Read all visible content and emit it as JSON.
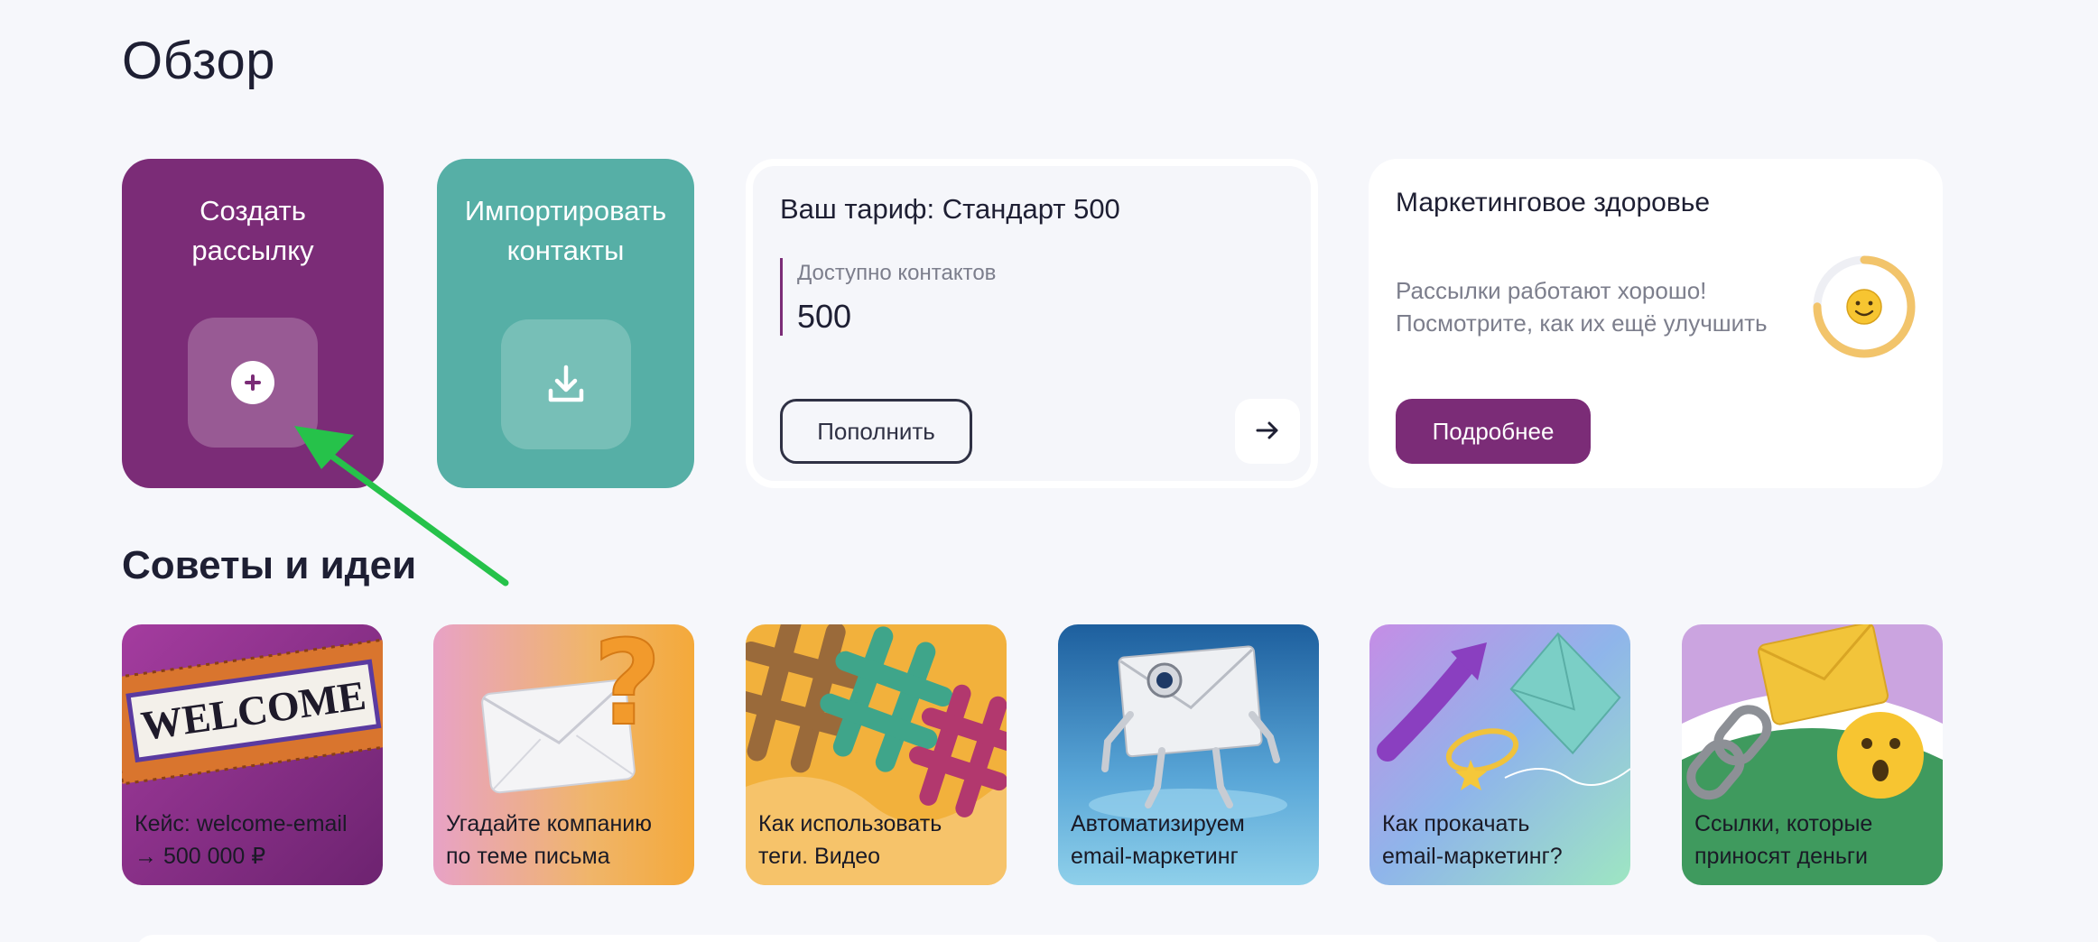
{
  "page": {
    "title": "Обзор"
  },
  "actions": {
    "create": {
      "label": "Создать рассылку",
      "icon": "plus-circle-icon",
      "color": "#7b2c77"
    },
    "import": {
      "label": "Импортировать контакты",
      "icon": "download-icon",
      "color": "#56afa6"
    }
  },
  "tariff": {
    "title": "Ваш тариф: Стандарт 500",
    "contacts_label": "Доступно контактов",
    "contacts_value": "500",
    "topup_label": "Пополнить",
    "arrow_icon": "arrow-right-icon"
  },
  "health": {
    "title": "Маркетинговое здоровье",
    "text_line1": "Рассылки работают хорошо!",
    "text_line2": "Посмотрите, как их ещё улучшить",
    "more_label": "Подробнее",
    "gauge_icon": "smiley-face-icon",
    "gauge_level": 0.75,
    "gauge_color": "#f2c46b"
  },
  "tips": {
    "title": "Советы и идеи",
    "items": [
      {
        "line1": "Кейс: welcome-email",
        "line2": "→ 500 000 ₽",
        "sign_text": "WELCOME"
      },
      {
        "line1": "Угадайте компанию",
        "line2": "по теме письма"
      },
      {
        "line1": "Как использовать",
        "line2": "теги. Видео"
      },
      {
        "line1": "Автоматизируем",
        "line2": "email-маркетинг"
      },
      {
        "line1": "Как прокачать",
        "line2": "email-маркетинг?"
      },
      {
        "line1": "Ссылки, которые",
        "line2": "приносят деньги"
      }
    ]
  }
}
